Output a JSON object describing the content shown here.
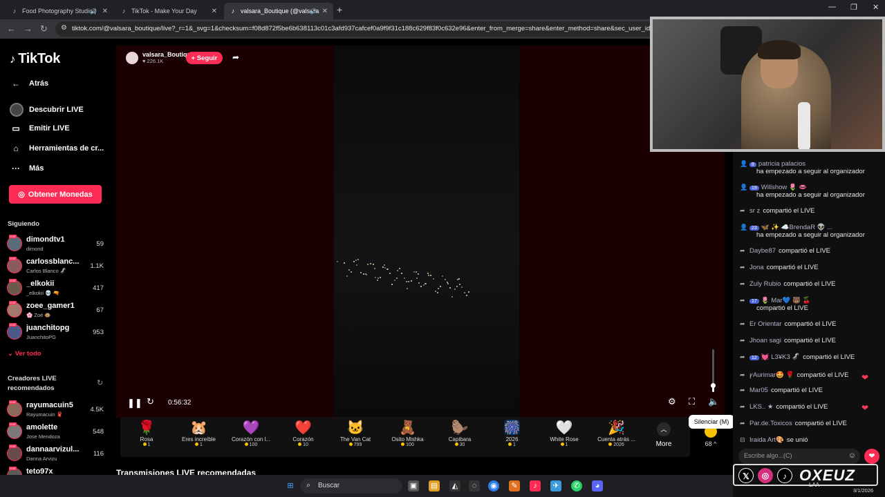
{
  "browser": {
    "tabs": [
      {
        "title": "Food Photography Studio |",
        "icon": "tiktok-icon"
      },
      {
        "title": "TikTok - Make Your Day",
        "icon": "tiktok-icon"
      },
      {
        "title": "valsara_Boutique (@valsara",
        "icon": "tiktok-icon"
      }
    ],
    "url": "tiktok.com/@valsara_boutique/live?_r=1&_svg=1&checksum=f08d872f5be6b638113c01c3afd937cafcef0a9f9f31c188c629f83f0c632e96&enter_from_merge=share&enter_method=share&sec_user_id=MS"
  },
  "sidebar": {
    "logo": "TikTok",
    "back": "Atrás",
    "nav": [
      {
        "label": "Descubrir LIVE",
        "icon": "discover-live-icon"
      },
      {
        "label": "Emitir LIVE",
        "icon": "broadcast-icon"
      },
      {
        "label": "Herramientas de cr...",
        "icon": "home-tools-icon"
      },
      {
        "label": "Más",
        "icon": "more-dots-icon"
      }
    ],
    "coins_button": "Obtener Monedas",
    "following_title": "Siguiendo",
    "following": [
      {
        "name": "dimondtv1",
        "sub": "dimond",
        "count": "59",
        "color": "#5a6b7a"
      },
      {
        "name": "carlossblanc...",
        "sub": "Carlos Blanco 🦨",
        "count": "1.1K",
        "color": "#8b5a5a"
      },
      {
        "name": "_elkokii",
        "sub": "_elkokii 💀 🔫",
        "count": "417",
        "color": "#6b5a4b"
      },
      {
        "name": "zoee_gamer1",
        "sub": "🌸 Zoé 🐵",
        "count": "67",
        "color": "#a07a6a"
      },
      {
        "name": "juanchitopg",
        "sub": "JuanchitoPG",
        "count": "953",
        "color": "#4b5a8b"
      }
    ],
    "see_all": "Ver todo",
    "recommended_title": "Creadores LIVE recomendados",
    "recommended": [
      {
        "name": "rayumacuin5",
        "sub": "Rayumacuin 🧣",
        "count": "4.5K",
        "color": "#8b6a5a"
      },
      {
        "name": "amolette",
        "sub": "Jose Mendoza",
        "count": "548",
        "color": "#7a7a7a"
      },
      {
        "name": "dannaarvizul...",
        "sub": "Danna Arvizu",
        "count": "116",
        "color": "#6a4b4b"
      },
      {
        "name": "teto97x",
        "sub": "",
        "count": "",
        "color": "#5a5a5a"
      }
    ]
  },
  "live": {
    "host_name": "valsara_Boutique",
    "host_likes": "♥ 226.1K",
    "follow_label": "+ Seguir",
    "timecode": "0:56:32",
    "volume_level": 0.15,
    "tooltip": "Silenciar (M)",
    "gifts": [
      {
        "name": "Rosa",
        "price": "1",
        "icon": "🌹"
      },
      {
        "name": "Eres increíble",
        "price": "1",
        "icon": "🐹"
      },
      {
        "name": "Corazón con l...",
        "price": "100",
        "icon": "💜"
      },
      {
        "name": "Corazón",
        "price": "10",
        "icon": "❤️"
      },
      {
        "name": "The Van Cat",
        "price": "799",
        "icon": "🐱"
      },
      {
        "name": "Osito Mishka",
        "price": "100",
        "icon": "🧸"
      },
      {
        "name": "Capibara",
        "price": "30",
        "icon": "🦫"
      },
      {
        "name": "2026",
        "price": "1",
        "icon": "🎆"
      },
      {
        "name": "White Rose",
        "price": "1",
        "icon": "🤍"
      },
      {
        "name": "Cuenta atrás ...",
        "price": "2026",
        "icon": "🎉"
      }
    ],
    "more_label": "More",
    "coin_count": "68 ^",
    "recommended_streams_title": "Transmisiones LIVE recomendadas"
  },
  "chat": {
    "messages": [
      {
        "badge": "8",
        "user": "patricia palacios",
        "text": "ha empezado a seguir al organizador",
        "icon": "follow-icon",
        "two_line": true
      },
      {
        "badge": "19",
        "user": "Willshow 🌷 👄",
        "text": "ha empezado a seguir al organizador",
        "icon": "follow-icon",
        "two_line": true
      },
      {
        "badge": "",
        "user": "sr z",
        "text": "compartió el LIVE",
        "icon": "share-icon",
        "two_line": false
      },
      {
        "badge": "23",
        "user": "🦋 ✨ ☁️BrendaR 👽 ...",
        "text": "ha empezado a seguir al organizador",
        "icon": "follow-icon",
        "two_line": true
      },
      {
        "badge": "",
        "user": "Daybe87",
        "text": "compartió el LIVE",
        "icon": "share-icon",
        "two_line": false
      },
      {
        "badge": "",
        "user": "Jona",
        "text": "compartió el LIVE",
        "icon": "share-icon",
        "two_line": false
      },
      {
        "badge": "",
        "user": "Zuly Rubio",
        "text": "compartió el LIVE",
        "icon": "share-icon",
        "two_line": false
      },
      {
        "badge": "17",
        "user": "🌷 Mar💙 🐻 🍒",
        "text": "compartió el LIVE",
        "icon": "share-icon",
        "two_line": true
      },
      {
        "badge": "",
        "user": "Er Orientar",
        "text": "compartió el LIVE",
        "icon": "share-icon",
        "two_line": false
      },
      {
        "badge": "",
        "user": "Jhoan sagi",
        "text": "compartió el LIVE",
        "icon": "share-icon",
        "two_line": false
      },
      {
        "badge": "12",
        "user": "💓 L3¥K3 🦨",
        "text": "compartió el LIVE",
        "icon": "share-icon",
        "two_line": false
      },
      {
        "badge": "",
        "user": "ꝩAurimar🤩 🌹",
        "text": "compartió el LIVE",
        "icon": "share-icon",
        "two_line": false
      },
      {
        "badge": "",
        "user": "Mar05",
        "text": "compartió el LIVE",
        "icon": "share-icon",
        "two_line": false
      },
      {
        "badge": "",
        "user": "LKS.. ★",
        "text": "compartió el LIVE",
        "icon": "share-icon",
        "two_line": false
      },
      {
        "badge": "",
        "user": "Par.de.Toxicos",
        "text": "compartió el LIVE",
        "icon": "share-icon",
        "two_line": false
      },
      {
        "badge": "",
        "user": "Iraida Art🎨",
        "text": "se unió",
        "icon": "join-icon",
        "two_line": false
      }
    ],
    "input_placeholder": "Escribe algo...(C)"
  },
  "overlay": {
    "handle": "OXEUZ"
  },
  "taskbar": {
    "search_placeholder": "Buscar",
    "language": "LAA",
    "date": "3/1/2026"
  }
}
